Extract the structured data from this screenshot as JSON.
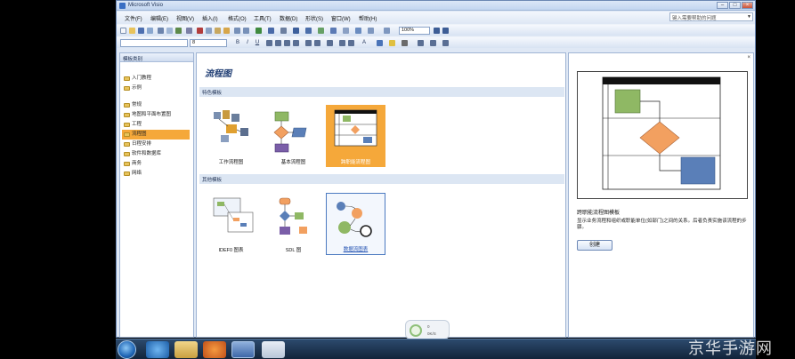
{
  "window": {
    "title": "Microsoft Visio"
  },
  "menu": [
    "文件(F)",
    "编辑(E)",
    "视图(V)",
    "插入(I)",
    "格式(O)",
    "工具(T)",
    "数据(D)",
    "形状(S)",
    "窗口(W)",
    "帮助(H)"
  ],
  "help_search": {
    "placeholder": "键入需要帮助的问题"
  },
  "toolbar": {
    "zoom": "100%",
    "font_size": "8"
  },
  "left_pane": {
    "header": "模板类别",
    "group1": [
      "入门教程",
      "示例"
    ],
    "group2": [
      "常规",
      "地图和平面布置图",
      "工程",
      "流程图",
      "日程安排",
      "软件和数据库",
      "商务",
      "网络"
    ],
    "selected": "流程图"
  },
  "center": {
    "title": "流程图",
    "featured_header": "特色模板",
    "featured": [
      "工作流程图",
      "基本流程图",
      "跨职能流程图"
    ],
    "other_header": "其他模板",
    "other": [
      "IDEF0 图表",
      "SDL 图",
      "数据流图表"
    ]
  },
  "right_pane": {
    "preview_title": "跨职能流程图模板",
    "description": "显示业务流程和组织或职能单位(如部门)之间的关系。后者负责实施该流程的步骤。",
    "create_button": "创建"
  },
  "status_widget": {
    "line1": "0",
    "line2": "0K/S"
  },
  "watermark": "京华手游网",
  "colors": {
    "selected": "#f5a83a",
    "shape_green": "#8fb864",
    "shape_orange": "#f2a060",
    "shape_blue": "#5a7fb8",
    "shape_purple": "#7a5ea8"
  }
}
